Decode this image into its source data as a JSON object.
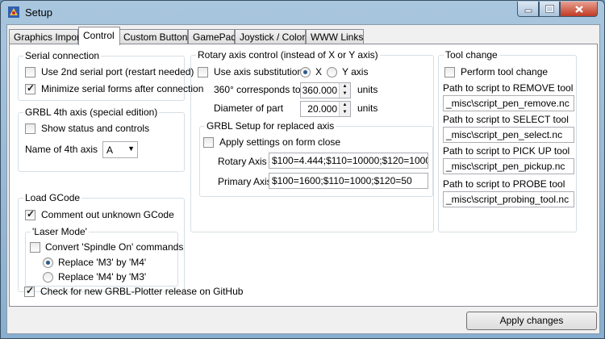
{
  "window": {
    "title": "Setup"
  },
  "tabs": [
    "Graphics Import",
    "Control",
    "Custom Buttons",
    "GamePad",
    "Joystick / Colors",
    "WWW Links"
  ],
  "serial": {
    "title": "Serial connection",
    "use2nd": "Use 2nd serial port (restart needed)",
    "minimize": "Minimize serial forms after connection"
  },
  "grbl4th": {
    "title": "GRBL 4th axis (special edition)",
    "show": "Show status and controls",
    "name_label": "Name of 4th axis",
    "name_value": "A"
  },
  "gcode": {
    "title": "Load GCode",
    "comment": "Comment out unknown GCode",
    "laser_title": "'Laser Mode'",
    "convert": "Convert 'Spindle On' commands",
    "m3": "Replace 'M3' by 'M4'",
    "m4": "Replace 'M4' by 'M3'"
  },
  "rotary": {
    "title": "Rotary axis control (instead of X or Y axis)",
    "use_sub": "Use axis substitution",
    "x": "X",
    "y": "Y axis",
    "deg_label": "360° corresponds to",
    "deg_value": "360.000",
    "deg_unit": "units",
    "dia_label": "Diameter of part",
    "dia_value": "20.000",
    "dia_unit": "units",
    "setup_title": "GRBL Setup for replaced axis",
    "apply_close": "Apply settings on form close",
    "rot_axis_label": "Rotary Axis",
    "rot_axis_value": "$100=4.444;$110=10000;$120=1000",
    "pri_axis_label": "Primary Axis",
    "pri_axis_value": "$100=1600;$110=1000;$120=50"
  },
  "tool": {
    "title": "Tool change",
    "perform": "Perform tool change",
    "remove_label": "Path to script to REMOVE tool",
    "remove_value": "_misc\\script_pen_remove.nc",
    "select_label": "Path to script to SELECT tool",
    "select_value": "_misc\\script_pen_select.nc",
    "pickup_label": "Path to script to PICK UP tool",
    "pickup_value": "_misc\\script_pen_pickup.nc",
    "probe_label": "Path to script to PROBE tool",
    "probe_value": "_misc\\script_probing_tool.nc"
  },
  "release": "Check for new GRBL-Plotter release on GitHub",
  "apply_button": "Apply changes"
}
